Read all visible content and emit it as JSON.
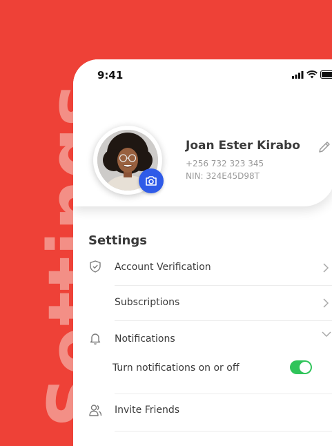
{
  "background_word": "Settings",
  "status_bar": {
    "time": "9:41"
  },
  "profile": {
    "name": "Joan Ester Kirabo",
    "phone": "+256 732 323 345",
    "nin": "NIN: 324E45D98T"
  },
  "settings": {
    "title": "Settings",
    "items": [
      {
        "label": "Account Verification"
      },
      {
        "label": "Subscriptions"
      },
      {
        "label": "Notifications"
      },
      {
        "label": "Turn notifications on or off"
      },
      {
        "label": "Invite Friends"
      }
    ],
    "notifications_toggle_on": true
  },
  "colors": {
    "accent": "#ee4137",
    "camera": "#2f5be8",
    "toggle_on": "#2fc45a"
  }
}
